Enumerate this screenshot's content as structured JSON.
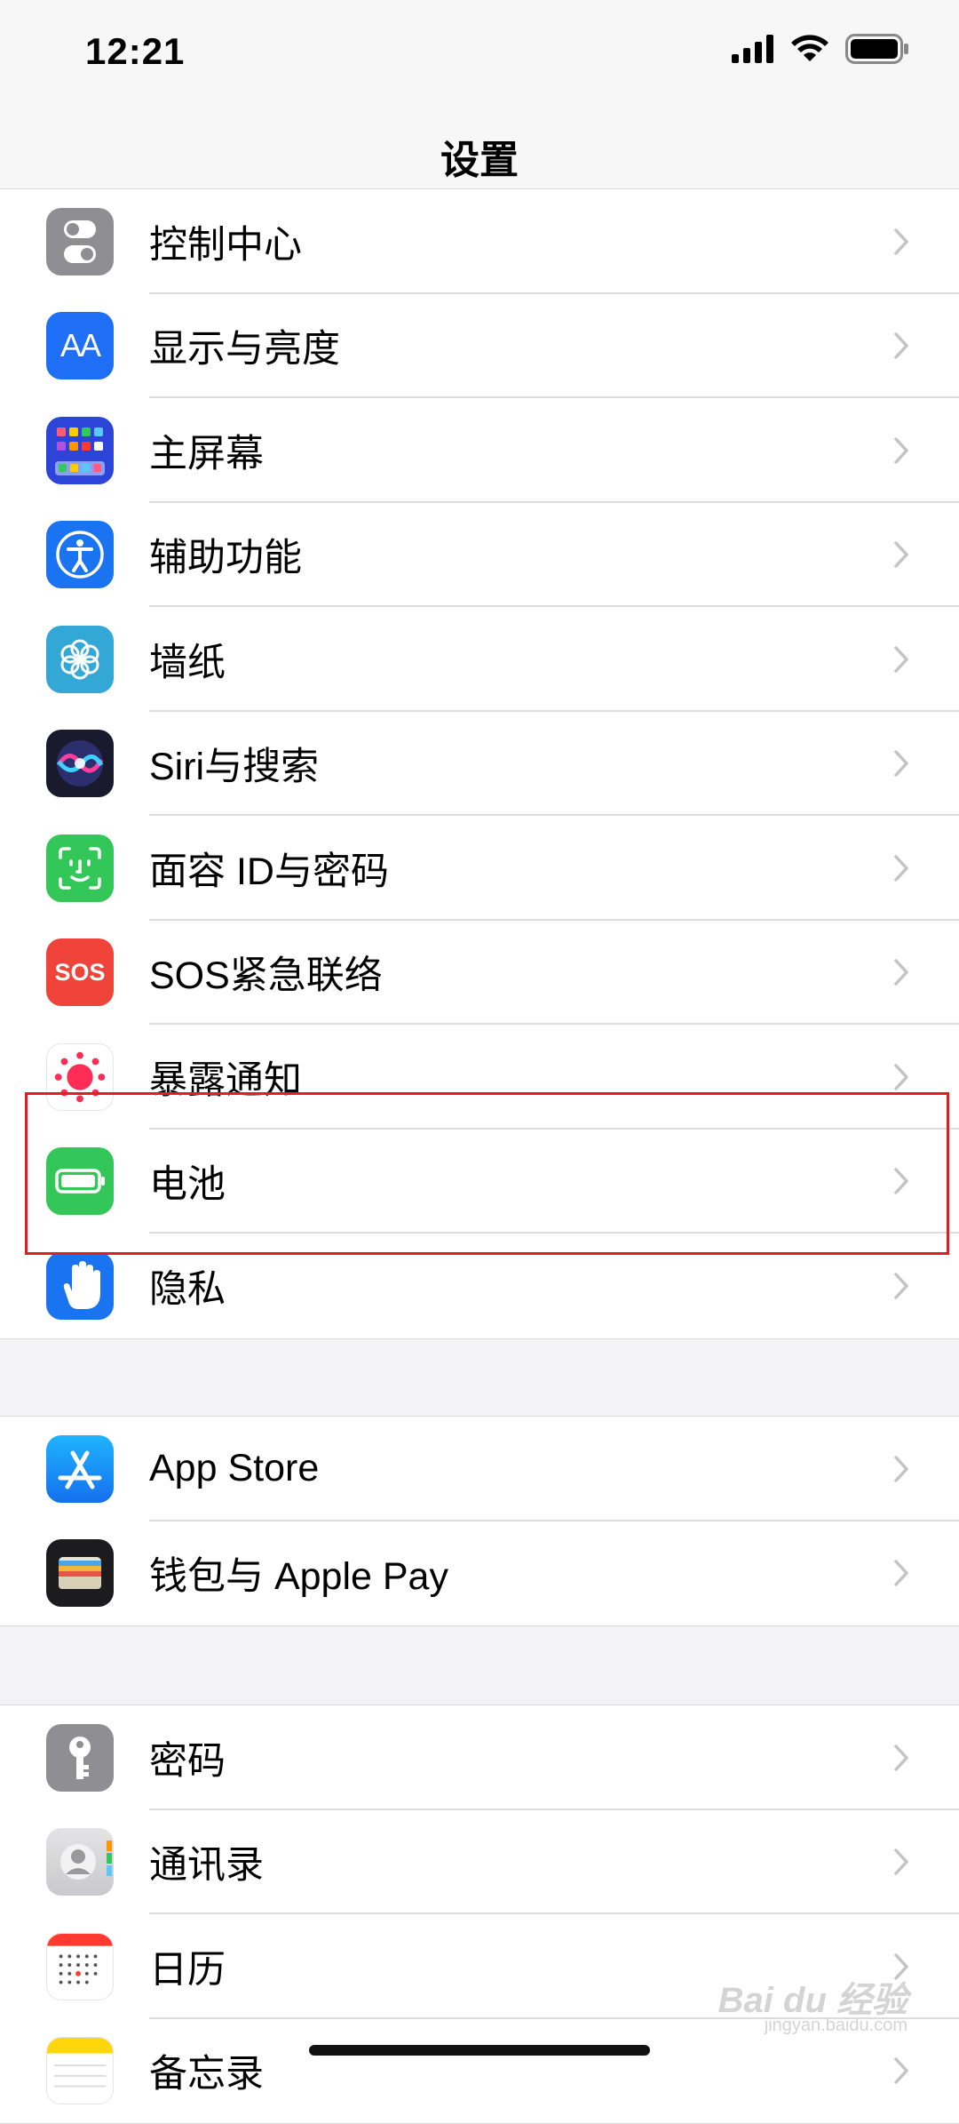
{
  "status_bar": {
    "time": "12:21"
  },
  "nav": {
    "title": "设置"
  },
  "groups": [
    {
      "items": [
        {
          "label": "控制中心",
          "icon": "control-center-icon",
          "color": "#8e8e93"
        },
        {
          "label": "显示与亮度",
          "icon": "display-brightness-icon",
          "color": "#1e6ff5",
          "glyph": "AA"
        },
        {
          "label": "主屏幕",
          "icon": "home-screen-icon",
          "color": "#2c44d8"
        },
        {
          "label": "辅助功能",
          "icon": "accessibility-icon",
          "color": "#1a73f0"
        },
        {
          "label": "墙纸",
          "icon": "wallpaper-icon",
          "color": "#33a7d6"
        },
        {
          "label": "Siri与搜索",
          "icon": "siri-icon",
          "color": "#1a1a2e"
        },
        {
          "label": "面容 ID与密码",
          "icon": "face-id-icon",
          "color": "#33c759"
        },
        {
          "label": "SOS紧急联络",
          "icon": "sos-icon",
          "color": "#f0433a",
          "glyph": "SOS"
        },
        {
          "label": "暴露通知",
          "icon": "exposure-notification-icon",
          "color": "#ffffff"
        },
        {
          "label": "电池",
          "icon": "battery-icon",
          "color": "#33c759"
        },
        {
          "label": "隐私",
          "icon": "privacy-hand-icon",
          "color": "#1a73f0"
        }
      ]
    },
    {
      "items": [
        {
          "label": "App Store",
          "icon": "app-store-icon",
          "color": "#1a8cf5"
        },
        {
          "label": "钱包与 Apple Pay",
          "icon": "wallet-icon",
          "color": "#1c1c1e"
        }
      ]
    },
    {
      "items": [
        {
          "label": "密码",
          "icon": "key-icon",
          "color": "#8e8e93"
        },
        {
          "label": "通讯录",
          "icon": "contacts-icon",
          "color": "#d6d6d6"
        },
        {
          "label": "日历",
          "icon": "calendar-icon",
          "color": "#ffffff"
        },
        {
          "label": "备忘录",
          "icon": "notes-icon",
          "color": "#ffffff"
        }
      ]
    }
  ],
  "watermark": {
    "text": "Bai du 经验",
    "sub": "jingyan.baidu.com"
  }
}
